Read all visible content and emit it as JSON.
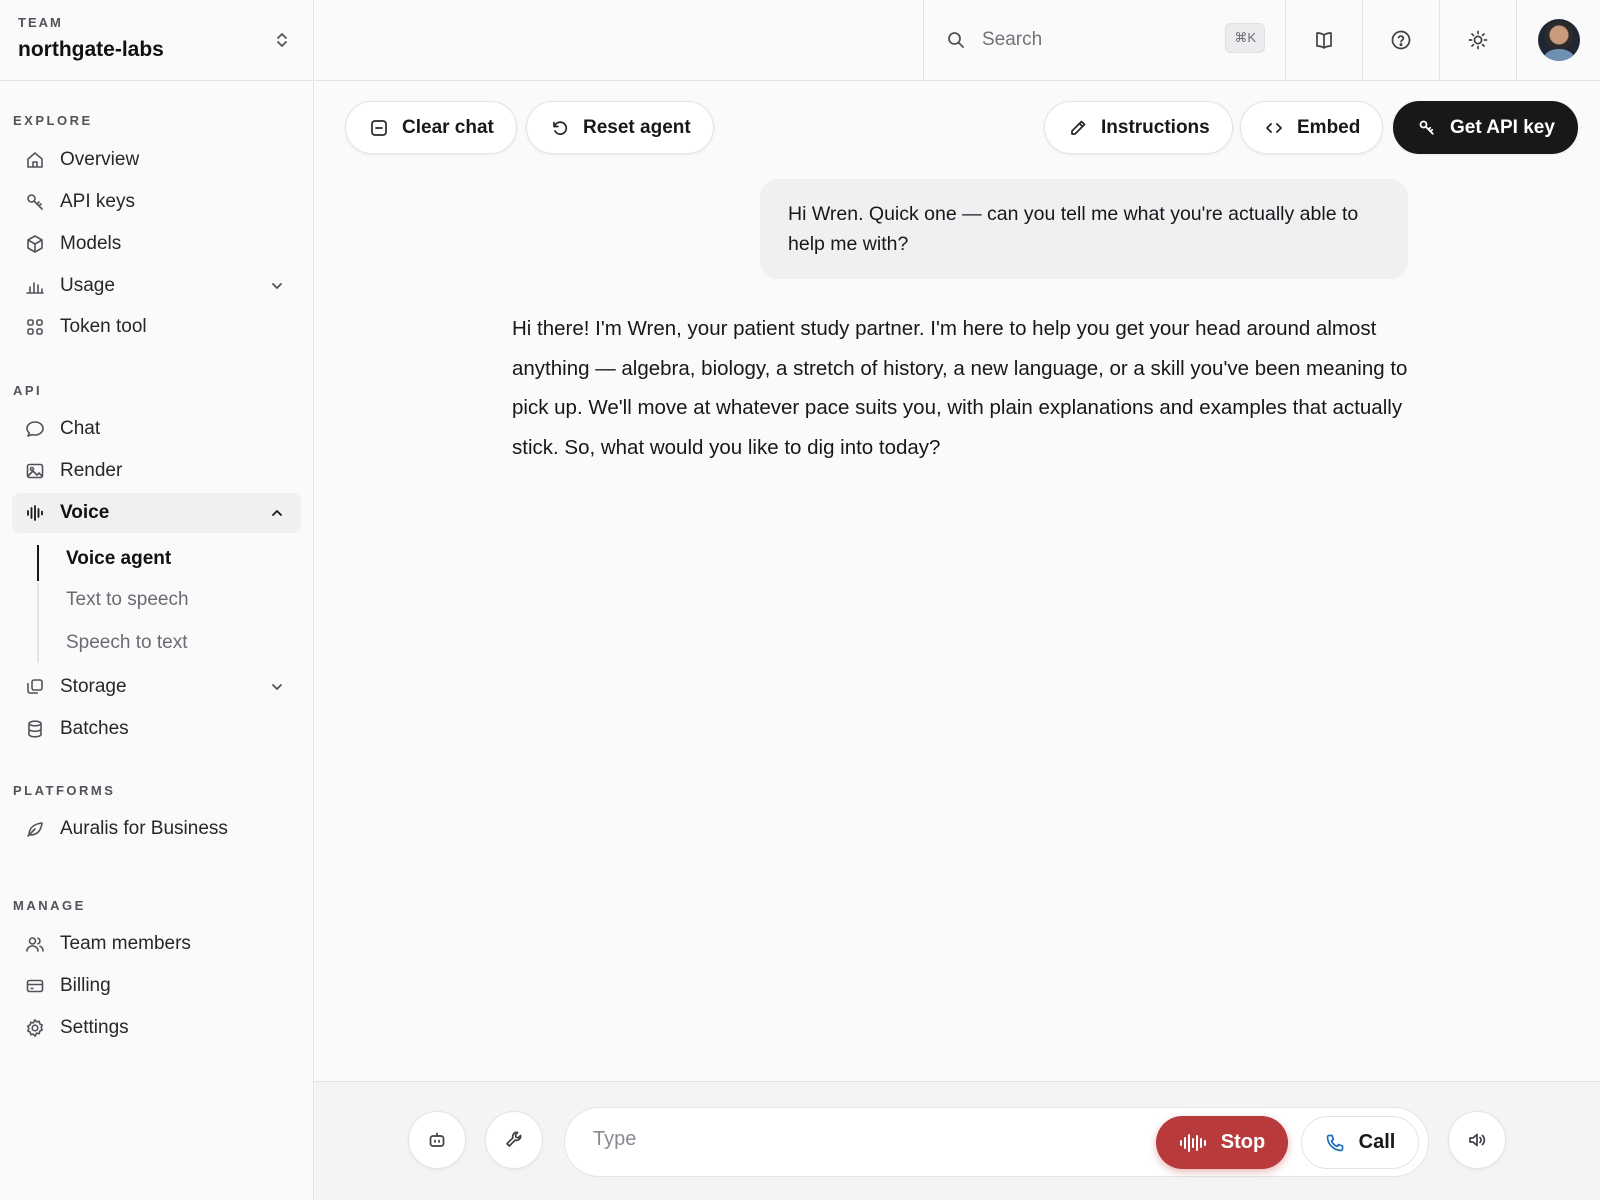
{
  "team": {
    "label": "TEAM",
    "name": "northgate-labs"
  },
  "sidebar": {
    "sections": {
      "explore": "EXPLORE",
      "api": "API",
      "platforms": "PLATFORMS",
      "manage": "MANAGE"
    },
    "items": {
      "overview": "Overview",
      "api_keys": "API keys",
      "models": "Models",
      "usage": "Usage",
      "token_tool": "Token tool",
      "chat": "Chat",
      "render": "Render",
      "voice": "Voice",
      "voice_agent": "Voice agent",
      "text_to_speech": "Text to speech",
      "speech_to_text": "Speech to text",
      "storage": "Storage",
      "batches": "Batches",
      "auralis_business": "Auralis for Business",
      "team_members": "Team members",
      "billing": "Billing",
      "settings": "Settings"
    }
  },
  "header": {
    "search_placeholder": "Search",
    "search_shortcut": "⌘K"
  },
  "toolbar": {
    "clear_chat": "Clear chat",
    "reset_agent": "Reset agent",
    "instructions": "Instructions",
    "embed": "Embed",
    "get_api_key": "Get API key"
  },
  "conversation": {
    "user_message": "Hi Wren. Quick one — can you tell me what you're actually able to help me with?",
    "assistant_message": "Hi there! I'm Wren, your patient study partner. I'm here to help you get your head around almost anything — algebra, biology, a stretch of history, a new language, or a skill you've been meaning to pick up. We'll move at whatever pace suits you, with plain explanations and examples that actually stick. So, what would you like to dig into today?"
  },
  "composer": {
    "placeholder": "Type",
    "stop_label": "Stop",
    "call_label": "Call"
  },
  "colors": {
    "accent_dark": "#18181b",
    "stop_red": "#b83a3a",
    "call_blue": "#1f6fb8"
  }
}
